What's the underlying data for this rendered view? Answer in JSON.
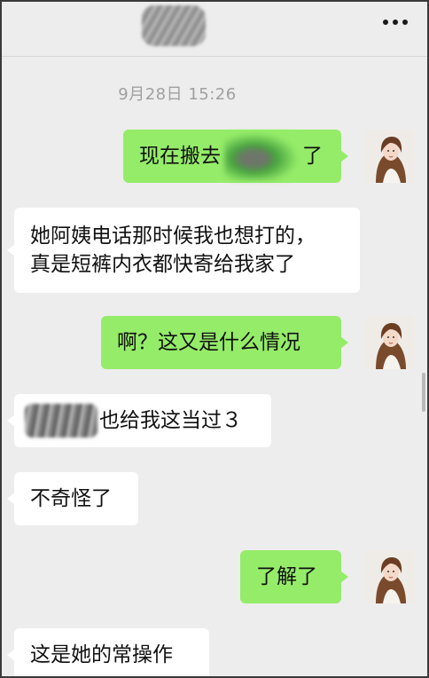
{
  "header": {
    "more_icon": "more-dots-icon"
  },
  "chat": {
    "timestamp": "9月28日 15:26",
    "messages": [
      {
        "side": "out",
        "text_before": "现在搬去",
        "text_after": "了",
        "has_redaction": true
      },
      {
        "side": "in",
        "lines": [
          "她阿姨电话那时候我也想打的，",
          "真是短裤内衣都快寄给我家了"
        ]
      },
      {
        "side": "out",
        "text": "啊？这又是什么情况"
      },
      {
        "side": "in",
        "text": "也给我这当过３",
        "has_redaction": true
      },
      {
        "side": "in",
        "text": "不奇怪了"
      },
      {
        "side": "out",
        "text": "了解了"
      },
      {
        "side": "in",
        "text": "这是她的常操作"
      }
    ]
  },
  "colors": {
    "background": "#ededed",
    "outgoing_bubble": "#95ec69",
    "incoming_bubble": "#ffffff",
    "timestamp_text": "#a0a0a0"
  }
}
